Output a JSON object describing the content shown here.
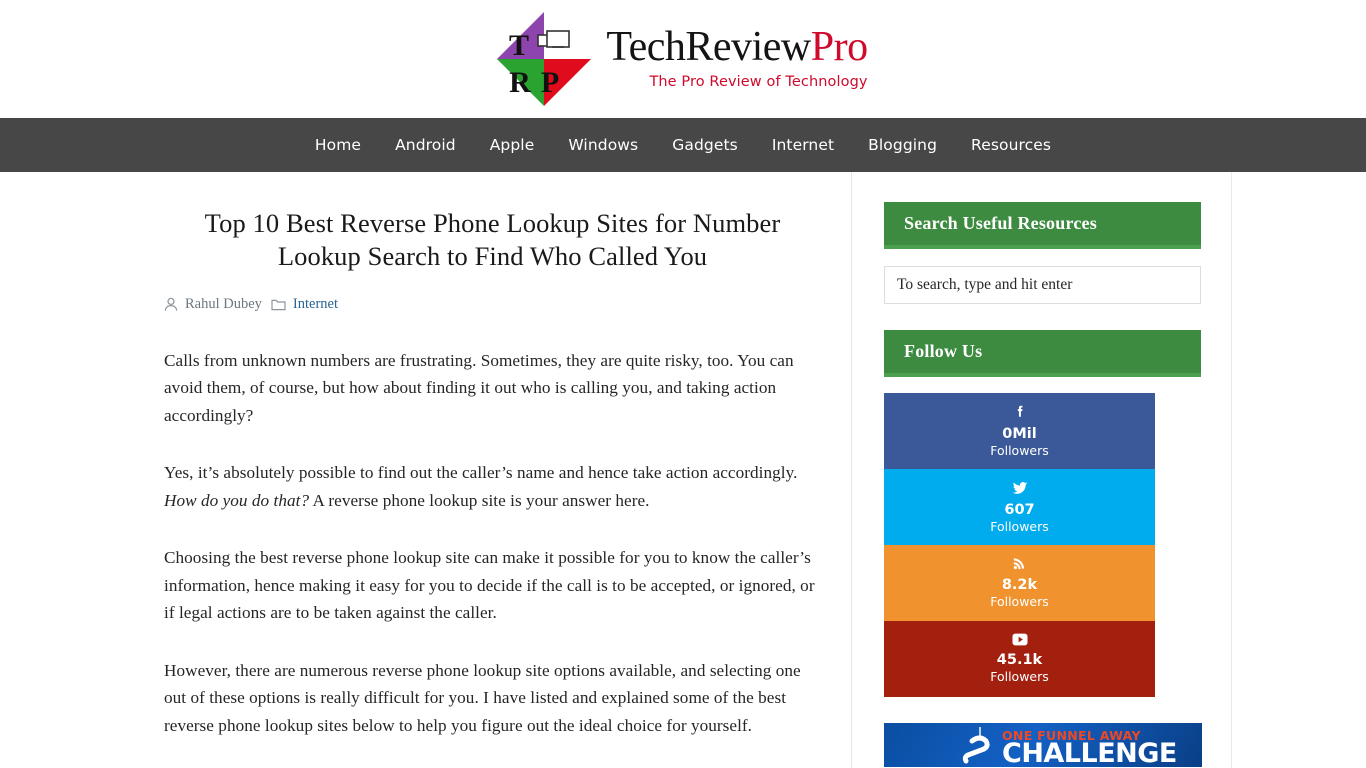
{
  "site": {
    "logo": {
      "letters": [
        "T",
        "R",
        "P"
      ],
      "title_part1": "TechReview",
      "title_part2": "Pro",
      "tagline": "The Pro Review of Technology",
      "colors": {
        "purple": "#8e44ad",
        "green": "#2aa331",
        "red": "#e00b1c",
        "brand_red": "#cf0a2c"
      }
    },
    "nav": {
      "items": [
        {
          "label": "Home"
        },
        {
          "label": "Android"
        },
        {
          "label": "Apple"
        },
        {
          "label": "Windows"
        },
        {
          "label": "Gadgets"
        },
        {
          "label": "Internet"
        },
        {
          "label": "Blogging"
        },
        {
          "label": "Resources"
        }
      ],
      "background": "#474747"
    }
  },
  "article": {
    "title": "Top 10 Best Reverse Phone Lookup Sites for Number Lookup Search to Find Who Called You",
    "meta": {
      "author_icon": "user-icon",
      "author": "Rahul Dubey",
      "category_icon": "folder-icon",
      "category": "Internet"
    },
    "paragraphs": [
      {
        "pre": "Calls from unknown numbers are frustrating. Sometimes, they are quite risky, too. You can avoid them, of course, but how about finding it out who is calling you, and taking action accordingly?",
        "em": "",
        "post": ""
      },
      {
        "pre": "Yes, it’s absolutely possible to find out the caller’s name and hence take action accordingly. ",
        "em": "How do you do that?",
        "post": " A reverse phone lookup site is your answer here."
      },
      {
        "pre": "Choosing the best reverse phone lookup site can make it possible for you to know the caller’s information, hence making it easy for you to decide if the call is to be accepted, or ignored, or if legal actions are to be taken against the caller.",
        "em": "",
        "post": ""
      },
      {
        "pre": "However, there are numerous reverse phone lookup site options available, and selecting one out of these options is really difficult for you. I have listed and explained some of the best reverse phone lookup sites below to help you figure out the ideal choice for yourself.",
        "em": "",
        "post": ""
      }
    ]
  },
  "sidebar": {
    "accent_color": "#3d8b40",
    "search_widget": {
      "title": "Search Useful Resources",
      "placeholder": "To search, type and hit enter",
      "value": ""
    },
    "follow_widget": {
      "title": "Follow Us",
      "items": [
        {
          "network": "facebook",
          "icon": "facebook-icon",
          "count": "0Mil",
          "label": "Followers",
          "color": "#3b5998"
        },
        {
          "network": "twitter",
          "icon": "twitter-icon",
          "count": "607",
          "label": "Followers",
          "color": "#00aced"
        },
        {
          "network": "rss",
          "icon": "rss-icon",
          "count": "8.2k",
          "label": "Followers",
          "color": "#f0932f"
        },
        {
          "network": "youtube",
          "icon": "youtube-icon",
          "count": "45.1k",
          "label": "Followers",
          "color": "#a3200f"
        }
      ]
    },
    "ad_banner": {
      "line1": "ONE FUNNEL AWAY",
      "line2": "CHALLENGE",
      "color1": "#ef4823",
      "color2": "#ffffff"
    }
  }
}
